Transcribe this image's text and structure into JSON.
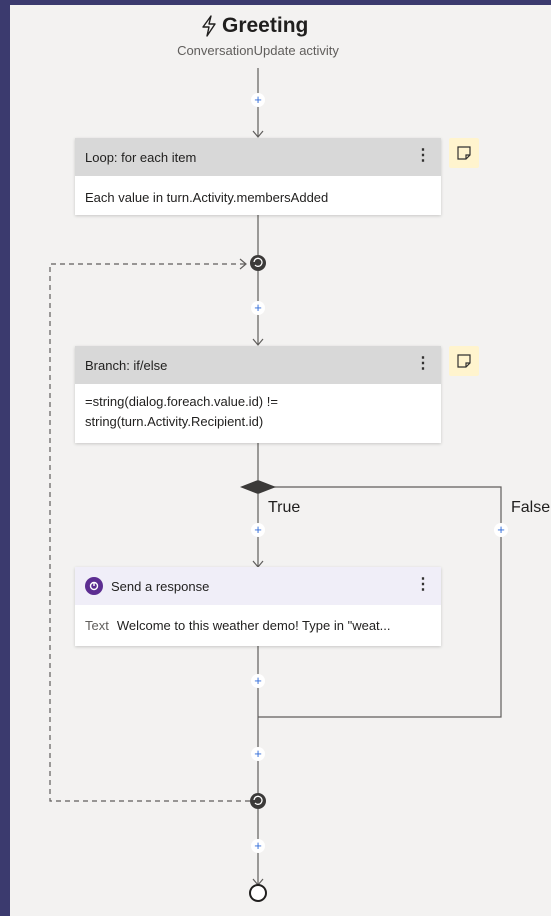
{
  "trigger": {
    "title": "Greeting",
    "subtitle": "ConversationUpdate activity",
    "icon": "lightning-icon"
  },
  "loop": {
    "header": "Loop: for each item",
    "body": "Each value in turn.Activity.membersAdded",
    "menu": "⋮"
  },
  "branch": {
    "header": "Branch: if/else",
    "body_line1": "=string(dialog.foreach.value.id) !=",
    "body_line2": "string(turn.Activity.Recipient.id)",
    "menu": "⋮",
    "true_label": "True",
    "false_label": "False"
  },
  "response": {
    "header": "Send a response",
    "text_label": "Text",
    "text_value": "Welcome to this weather demo! Type in \"weat...",
    "menu": "⋮"
  },
  "plus_symbol": "+",
  "colors": {
    "frame": "#3b3a6e",
    "canvas": "#f3f2f1",
    "header_gray": "#d8d8d8",
    "note_yellow": "#fff4ce",
    "plus_blue": "#2f6bd8",
    "response_purple": "#5c2d91",
    "connector_gray": "#605e5c",
    "node_dark": "#3b3a39"
  }
}
